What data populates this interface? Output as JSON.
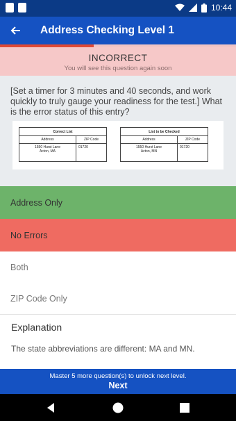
{
  "status_bar": {
    "time": "10:44"
  },
  "app_bar": {
    "title": "Address Checking Level 1"
  },
  "result": {
    "heading": "INCORRECT",
    "subtext": "You will see this question again soon"
  },
  "question": {
    "text": "[Set a timer for 3 minutes and 40 seconds, and work quickly to truly gauge your readiness for the test.] What is the error status of this entry?",
    "table": {
      "left_title": "Correct List",
      "right_title": "List to be Checked",
      "col_address": "Address",
      "col_zip": "ZIP Code",
      "left_address_line1": "1550 Hurst Lane",
      "left_address_line2": "Acton, MA",
      "left_zip": "01720",
      "right_address_line1": "1550 Hurst Lane",
      "right_address_line2": "Acton, MN",
      "right_zip": "01720"
    }
  },
  "options": [
    {
      "label": "Address Only",
      "state": "correct",
      "color": "#6db36a"
    },
    {
      "label": "No Errors",
      "state": "selected-wrong",
      "color": "#ef6b61"
    },
    {
      "label": "Both",
      "state": "unselected"
    },
    {
      "label": "ZIP Code Only",
      "state": "unselected"
    }
  ],
  "explanation": {
    "heading": "Explanation",
    "text": "The state abbreviations are different: MA and MN."
  },
  "footer": {
    "message": "Master 5 more question(s) to unlock next level.",
    "next_label": "Next"
  },
  "colors": {
    "app_bar": "#1552c2",
    "status_bar": "#0b3a86",
    "incorrect_banner": "#f6c8c8"
  },
  "icons": [
    "notification-square-icon",
    "notification-square-icon",
    "wifi-icon",
    "signal-icon",
    "battery-icon",
    "back-arrow-icon",
    "nav-back-icon",
    "nav-home-icon",
    "nav-recents-icon"
  ]
}
